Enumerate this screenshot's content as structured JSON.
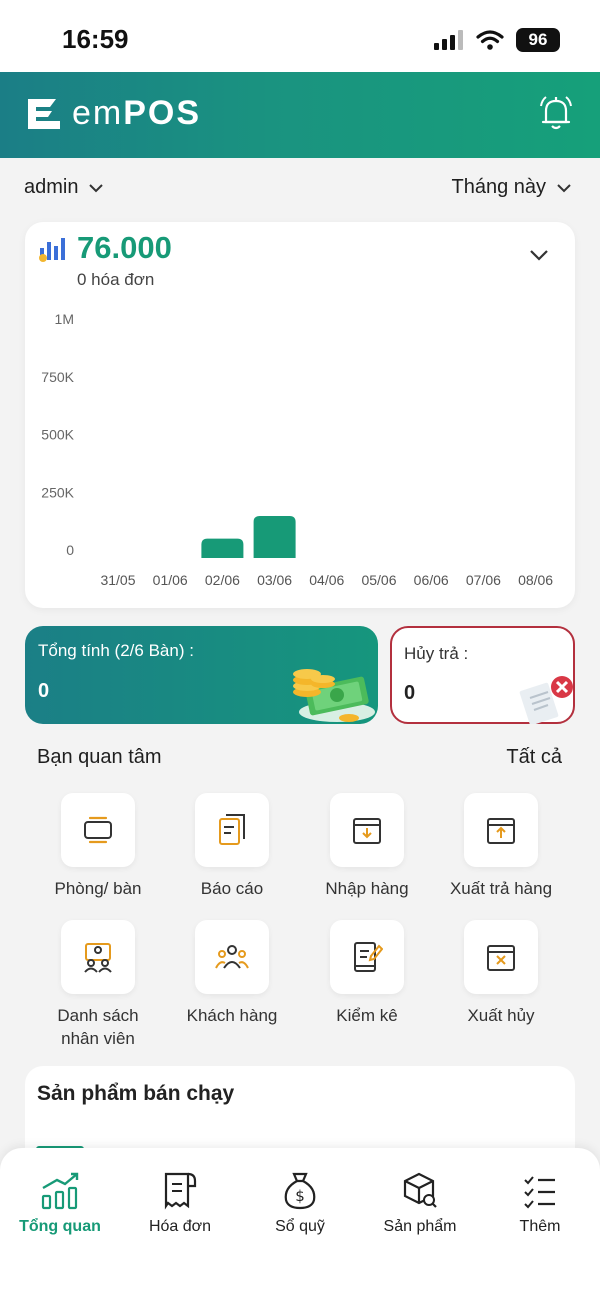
{
  "status": {
    "time": "16:59",
    "battery": "96"
  },
  "header": {
    "logo_em": "em",
    "logo_pos": "POS"
  },
  "filters": {
    "user": "admin",
    "period": "Tháng này"
  },
  "revenue": {
    "amount": "76.000",
    "invoices": "0 hóa đơn"
  },
  "chart_data": {
    "type": "bar",
    "categories": [
      "31/05",
      "01/06",
      "02/06",
      "03/06",
      "04/06",
      "05/06",
      "06/06",
      "07/06",
      "08/06"
    ],
    "values": [
      0,
      0,
      24000,
      52000,
      0,
      0,
      0,
      0,
      0
    ],
    "yticks": [
      "1M",
      "750K",
      "500K",
      "250K",
      "0"
    ],
    "ylim": [
      0,
      1000000
    ],
    "bar_color": "#179a77"
  },
  "summary": {
    "total_label": "Tổng tính (2/6 Bàn) :",
    "total_value": "0",
    "cancel_label": "Hủy trả :",
    "cancel_value": "0"
  },
  "interests": {
    "title": "Bạn quan tâm",
    "see_all": "Tất cả",
    "items": [
      {
        "label": "Phòng/ bàn",
        "icon": "table-icon"
      },
      {
        "label": "Báo cáo",
        "icon": "report-icon"
      },
      {
        "label": "Nhập hàng",
        "icon": "import-icon"
      },
      {
        "label": "Xuất trả hàng",
        "icon": "export-return-icon"
      },
      {
        "label": "Danh sách\nnhân viên",
        "icon": "staff-list-icon"
      },
      {
        "label": "Khách hàng",
        "icon": "customers-icon"
      },
      {
        "label": "Kiểm kê",
        "icon": "inventory-check-icon"
      },
      {
        "label": "Xuất hủy",
        "icon": "export-cancel-icon"
      }
    ]
  },
  "bestseller": {
    "title": "Sản phẩm bán chạy"
  },
  "tabs": [
    {
      "label": "Tổng quan",
      "icon": "overview-chart-icon"
    },
    {
      "label": "Hóa đơn",
      "icon": "invoice-icon"
    },
    {
      "label": "Sổ quỹ",
      "icon": "money-bag-icon"
    },
    {
      "label": "Sản phẩm",
      "icon": "product-box-icon"
    },
    {
      "label": "Thêm",
      "icon": "more-list-icon"
    }
  ],
  "colors": {
    "primary": "#179a77",
    "header_start": "#1b7e86",
    "danger": "#b3303e"
  }
}
